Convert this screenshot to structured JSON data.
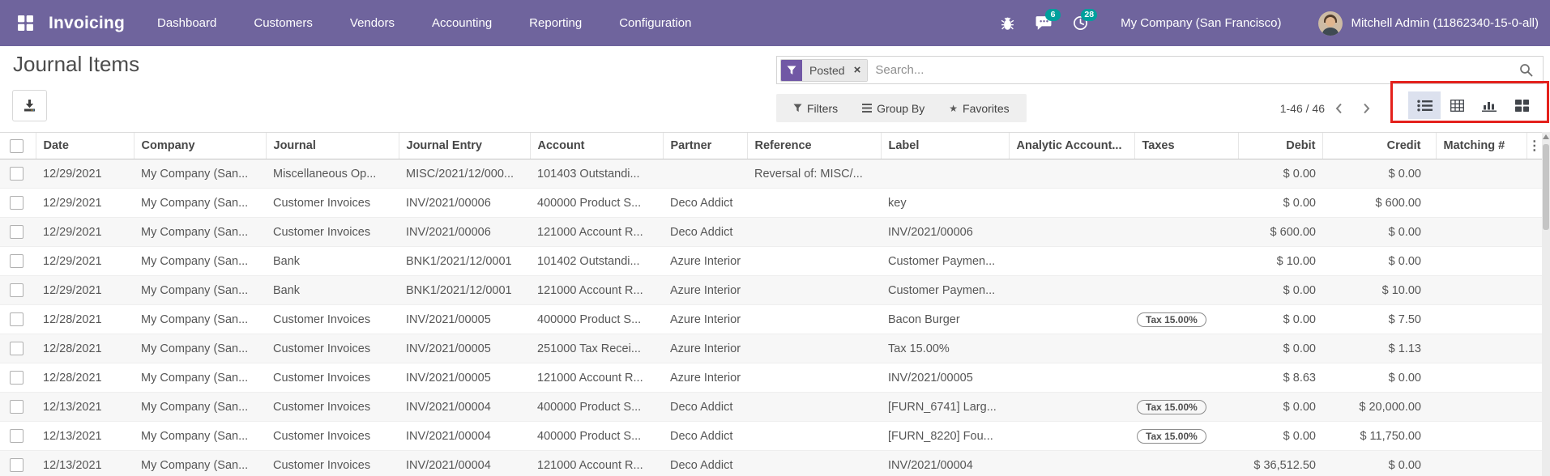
{
  "navbar": {
    "app_name": "Invoicing",
    "menu_items": [
      "Dashboard",
      "Customers",
      "Vendors",
      "Accounting",
      "Reporting",
      "Configuration"
    ],
    "messages_count": "6",
    "activities_count": "28",
    "company": "My Company (San Francisco)",
    "user": "Mitchell Admin (11862340-15-0-all)",
    "colors": {
      "background": "#6f649d",
      "badge": "#00a09d"
    }
  },
  "control_panel": {
    "title": "Journal Items",
    "search": {
      "facet": "Posted",
      "placeholder": "Search..."
    },
    "buttons": {
      "filters": "Filters",
      "group_by": "Group By",
      "favorites": "Favorites"
    },
    "pager": {
      "text": "1-46 / 46"
    },
    "annotation_color": "#e4211c"
  },
  "icons": {
    "facet_remove": "×",
    "options_toggle": "⋮",
    "favorites_star": "★"
  },
  "table": {
    "columns": [
      {
        "id": "date",
        "label": "Date"
      },
      {
        "id": "company",
        "label": "Company"
      },
      {
        "id": "journal",
        "label": "Journal"
      },
      {
        "id": "journal_entry",
        "label": "Journal Entry"
      },
      {
        "id": "account",
        "label": "Account"
      },
      {
        "id": "partner",
        "label": "Partner"
      },
      {
        "id": "reference",
        "label": "Reference"
      },
      {
        "id": "label",
        "label": "Label"
      },
      {
        "id": "analytic",
        "label": "Analytic Account..."
      },
      {
        "id": "taxes",
        "label": "Taxes"
      },
      {
        "id": "debit",
        "label": "Debit",
        "align": "right"
      },
      {
        "id": "credit",
        "label": "Credit",
        "align": "right"
      },
      {
        "id": "matching",
        "label": "Matching #"
      }
    ],
    "rows": [
      {
        "date": "12/29/2021",
        "company": "My Company (San...",
        "journal": "Miscellaneous Op...",
        "journal_entry": "MISC/2021/12/000...",
        "account": "101403 Outstandi...",
        "partner": "",
        "reference": "Reversal of: MISC/...",
        "label": "",
        "analytic": "",
        "taxes": "",
        "debit": "$ 0.00",
        "credit": "$ 0.00",
        "matching": ""
      },
      {
        "date": "12/29/2021",
        "company": "My Company (San...",
        "journal": "Customer Invoices",
        "journal_entry": "INV/2021/00006",
        "account": "400000 Product S...",
        "partner": "Deco Addict",
        "reference": "",
        "label": "key",
        "analytic": "",
        "taxes": "",
        "debit": "$ 0.00",
        "credit": "$ 600.00",
        "matching": ""
      },
      {
        "date": "12/29/2021",
        "company": "My Company (San...",
        "journal": "Customer Invoices",
        "journal_entry": "INV/2021/00006",
        "account": "121000 Account R...",
        "partner": "Deco Addict",
        "reference": "",
        "label": "INV/2021/00006",
        "analytic": "",
        "taxes": "",
        "debit": "$ 600.00",
        "credit": "$ 0.00",
        "matching": ""
      },
      {
        "date": "12/29/2021",
        "company": "My Company (San...",
        "journal": "Bank",
        "journal_entry": "BNK1/2021/12/0001",
        "account": "101402 Outstandi...",
        "partner": "Azure Interior",
        "reference": "",
        "label": "Customer Paymen...",
        "analytic": "",
        "taxes": "",
        "debit": "$ 10.00",
        "credit": "$ 0.00",
        "matching": ""
      },
      {
        "date": "12/29/2021",
        "company": "My Company (San...",
        "journal": "Bank",
        "journal_entry": "BNK1/2021/12/0001",
        "account": "121000 Account R...",
        "partner": "Azure Interior",
        "reference": "",
        "label": "Customer Paymen...",
        "analytic": "",
        "taxes": "",
        "debit": "$ 0.00",
        "credit": "$ 10.00",
        "matching": ""
      },
      {
        "date": "12/28/2021",
        "company": "My Company (San...",
        "journal": "Customer Invoices",
        "journal_entry": "INV/2021/00005",
        "account": "400000 Product S...",
        "partner": "Azure Interior",
        "reference": "",
        "label": "Bacon Burger",
        "analytic": "",
        "taxes": "Tax 15.00%",
        "debit": "$ 0.00",
        "credit": "$ 7.50",
        "matching": ""
      },
      {
        "date": "12/28/2021",
        "company": "My Company (San...",
        "journal": "Customer Invoices",
        "journal_entry": "INV/2021/00005",
        "account": "251000 Tax Recei...",
        "partner": "Azure Interior",
        "reference": "",
        "label": "Tax 15.00%",
        "analytic": "",
        "taxes": "",
        "debit": "$ 0.00",
        "credit": "$ 1.13",
        "matching": ""
      },
      {
        "date": "12/28/2021",
        "company": "My Company (San...",
        "journal": "Customer Invoices",
        "journal_entry": "INV/2021/00005",
        "account": "121000 Account R...",
        "partner": "Azure Interior",
        "reference": "",
        "label": "INV/2021/00005",
        "analytic": "",
        "taxes": "",
        "debit": "$ 8.63",
        "credit": "$ 0.00",
        "matching": ""
      },
      {
        "date": "12/13/2021",
        "company": "My Company (San...",
        "journal": "Customer Invoices",
        "journal_entry": "INV/2021/00004",
        "account": "400000 Product S...",
        "partner": "Deco Addict",
        "reference": "",
        "label": "[FURN_6741] Larg...",
        "analytic": "",
        "taxes": "Tax 15.00%",
        "debit": "$ 0.00",
        "credit": "$ 20,000.00",
        "matching": ""
      },
      {
        "date": "12/13/2021",
        "company": "My Company (San...",
        "journal": "Customer Invoices",
        "journal_entry": "INV/2021/00004",
        "account": "400000 Product S...",
        "partner": "Deco Addict",
        "reference": "",
        "label": "[FURN_8220] Fou...",
        "analytic": "",
        "taxes": "Tax 15.00%",
        "debit": "$ 0.00",
        "credit": "$ 11,750.00",
        "matching": ""
      },
      {
        "date": "12/13/2021",
        "company": "My Company (San...",
        "journal": "Customer Invoices",
        "journal_entry": "INV/2021/00004",
        "account": "121000 Account R...",
        "partner": "Deco Addict",
        "reference": "",
        "label": "INV/2021/00004",
        "analytic": "",
        "taxes": "",
        "debit": "$ 36,512.50",
        "credit": "$ 0.00",
        "matching": ""
      }
    ]
  }
}
